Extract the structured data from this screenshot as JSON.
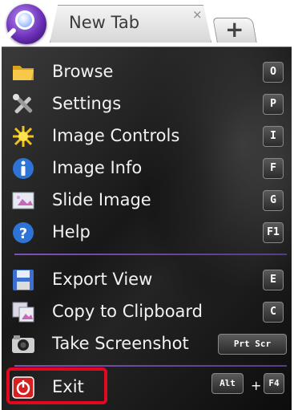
{
  "tab": {
    "title": "New Tab",
    "close_glyph": "×",
    "new_tab_glyph": "+"
  },
  "menu": {
    "items": [
      {
        "label": "Browse",
        "shortcut": "O",
        "icon": "folder-icon"
      },
      {
        "label": "Settings",
        "shortcut": "P",
        "icon": "tools-icon"
      },
      {
        "label": "Image Controls",
        "shortcut": "I",
        "icon": "sun-icon"
      },
      {
        "label": "Image Info",
        "shortcut": "F",
        "icon": "info-icon"
      },
      {
        "label": "Slide Image",
        "shortcut": "G",
        "icon": "slide-icon"
      },
      {
        "label": "Help",
        "shortcut": "F1",
        "icon": "help-icon"
      },
      {
        "label": "Export View",
        "shortcut": "E",
        "icon": "save-icon"
      },
      {
        "label": "Copy to Clipboard",
        "shortcut": "C",
        "icon": "clipboard-icon"
      },
      {
        "label": "Take Screenshot",
        "shortcut": "Prt Scr",
        "icon": "camera-icon"
      }
    ],
    "exit": {
      "label": "Exit",
      "shortcut_mod": "Alt",
      "shortcut_plus": "+",
      "shortcut_key": "F4",
      "icon": "power-icon"
    }
  },
  "colors": {
    "highlight": "#e1091f",
    "separator": "#7d4fb8",
    "accent_orb": "#6a2fb8"
  }
}
